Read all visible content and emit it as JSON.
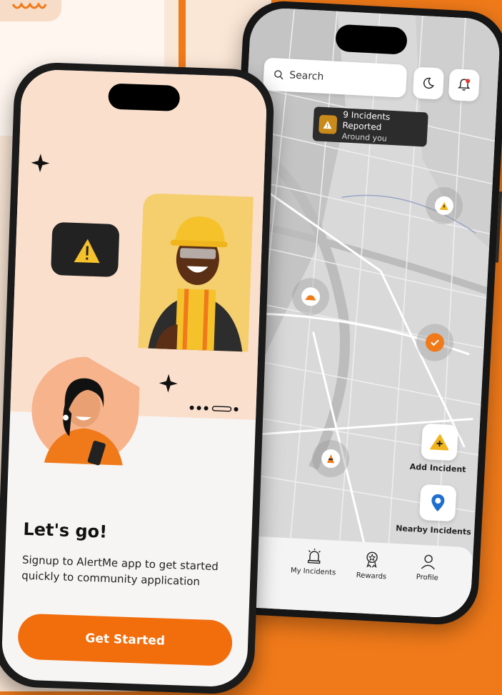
{
  "colors": {
    "brand": "#f26d0c",
    "background": "#f07a1a",
    "cream": "#fbdfcd"
  },
  "map_screen": {
    "search": {
      "placeholder": "Search",
      "icon": "search-icon"
    },
    "theme_icon": "moon-icon",
    "notification_icon": "bell-icon",
    "banner": {
      "title": "9 Incidents Reported",
      "subtitle": "Around you",
      "icon": "warning-icon"
    },
    "actions": {
      "add_incident": "Add Incident",
      "nearby_incidents": "Nearby Incidents"
    },
    "tabs": [
      {
        "label": "My Incidents",
        "icon": "alarm-icon"
      },
      {
        "label": "Rewards",
        "icon": "badge-icon"
      },
      {
        "label": "Profile",
        "icon": "user-icon"
      }
    ]
  },
  "onboarding": {
    "heading": "Let's go!",
    "subtitle": "Signup to AlertMe app to get started quickly to community application",
    "cta": "Get Started",
    "pagination": {
      "pages": 4,
      "active": 4
    }
  }
}
